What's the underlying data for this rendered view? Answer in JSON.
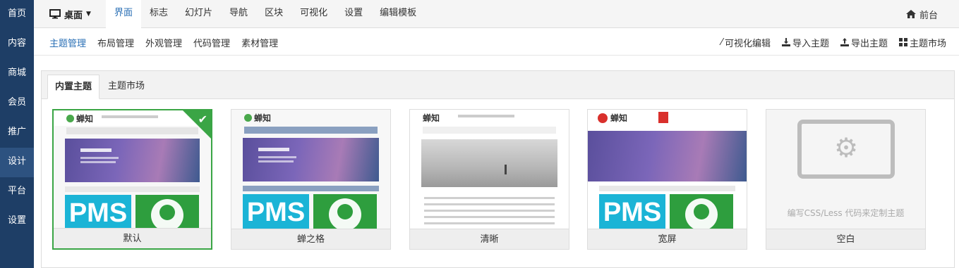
{
  "left_nav": {
    "items": [
      "首页",
      "内容",
      "商城",
      "会员",
      "推广",
      "设计",
      "平台",
      "设置"
    ],
    "active_index": 5
  },
  "topbar": {
    "device_label": "桌面",
    "tabs": [
      "界面",
      "标志",
      "幻灯片",
      "导航",
      "区块",
      "可视化",
      "设置",
      "编辑模板"
    ],
    "active_tab": 0,
    "front_label": "前台"
  },
  "subbar": {
    "tabs": [
      "主题管理",
      "布局管理",
      "外观管理",
      "代码管理",
      "素材管理"
    ],
    "active_tab": 0,
    "actions": [
      "可视化编辑",
      "导入主题",
      "导出主题",
      "主题市场"
    ]
  },
  "panel": {
    "tabs": [
      "内置主题",
      "主题市场"
    ],
    "active_tab": 0
  },
  "themes": [
    {
      "name": "默认",
      "active": true
    },
    {
      "name": "蝉之格",
      "active": false
    },
    {
      "name": "清晰",
      "active": false
    },
    {
      "name": "宽屏",
      "active": false
    },
    {
      "name": "空白",
      "active": false
    }
  ],
  "thumb": {
    "logo": "蝉知",
    "pms": "PMS",
    "blank_hint": "编写CSS/Less 代码来定制主题"
  },
  "colors": {
    "nav_bg": "#1e3e66",
    "accent": "#2a6fb5",
    "active_green": "#3aa545"
  }
}
